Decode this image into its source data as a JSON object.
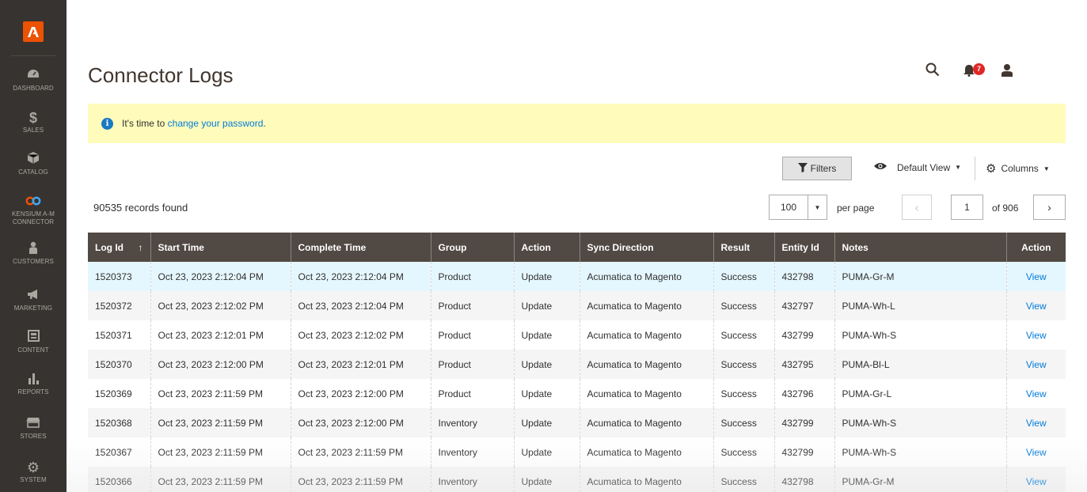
{
  "sidebar": {
    "items": [
      {
        "label": "DASHBOARD",
        "icon": "dashboard-icon"
      },
      {
        "label": "SALES",
        "icon": "dollar-icon"
      },
      {
        "label": "CATALOG",
        "icon": "cube-icon"
      },
      {
        "label": "KENSIUM A-M CONNECTOR",
        "icon": "infinity-icon"
      },
      {
        "label": "CUSTOMERS",
        "icon": "person-icon"
      },
      {
        "label": "MARKETING",
        "icon": "megaphone-icon"
      },
      {
        "label": "CONTENT",
        "icon": "layout-icon"
      },
      {
        "label": "REPORTS",
        "icon": "bar-chart-icon"
      },
      {
        "label": "STORES",
        "icon": "store-icon"
      },
      {
        "label": "SYSTEM",
        "icon": "gear-icon"
      }
    ]
  },
  "header": {
    "title": "Connector Logs",
    "notification_count": "7"
  },
  "message": {
    "prefix": "It's time to ",
    "link": "change your password",
    "suffix": "."
  },
  "toolbar": {
    "filters_label": "Filters",
    "view_label": "Default View",
    "columns_label": "Columns",
    "records_found": "90535 records found",
    "per_page_value": "100",
    "per_page_label": "per page",
    "current_page": "1",
    "total_pages": "of 906"
  },
  "table": {
    "columns": [
      "Log Id",
      "Start Time",
      "Complete Time",
      "Group",
      "Action",
      "Sync Direction",
      "Result",
      "Entity Id",
      "Notes",
      "Action"
    ],
    "rows": [
      {
        "log_id": "1520373",
        "start": "Oct 23, 2023 2:12:04 PM",
        "complete": "Oct 23, 2023 2:12:04 PM",
        "group": "Product",
        "action": "Update",
        "direction": "Acumatica to Magento",
        "result": "Success",
        "entity": "432798",
        "notes": "PUMA-Gr-M",
        "link": "View"
      },
      {
        "log_id": "1520372",
        "start": "Oct 23, 2023 2:12:02 PM",
        "complete": "Oct 23, 2023 2:12:04 PM",
        "group": "Product",
        "action": "Update",
        "direction": "Acumatica to Magento",
        "result": "Success",
        "entity": "432797",
        "notes": "PUMA-Wh-L",
        "link": "View"
      },
      {
        "log_id": "1520371",
        "start": "Oct 23, 2023 2:12:01 PM",
        "complete": "Oct 23, 2023 2:12:02 PM",
        "group": "Product",
        "action": "Update",
        "direction": "Acumatica to Magento",
        "result": "Success",
        "entity": "432799",
        "notes": "PUMA-Wh-S",
        "link": "View"
      },
      {
        "log_id": "1520370",
        "start": "Oct 23, 2023 2:12:00 PM",
        "complete": "Oct 23, 2023 2:12:01 PM",
        "group": "Product",
        "action": "Update",
        "direction": "Acumatica to Magento",
        "result": "Success",
        "entity": "432795",
        "notes": "PUMA-Bl-L",
        "link": "View"
      },
      {
        "log_id": "1520369",
        "start": "Oct 23, 2023 2:11:59 PM",
        "complete": "Oct 23, 2023 2:12:00 PM",
        "group": "Product",
        "action": "Update",
        "direction": "Acumatica to Magento",
        "result": "Success",
        "entity": "432796",
        "notes": "PUMA-Gr-L",
        "link": "View"
      },
      {
        "log_id": "1520368",
        "start": "Oct 23, 2023 2:11:59 PM",
        "complete": "Oct 23, 2023 2:12:00 PM",
        "group": "Inventory",
        "action": "Update",
        "direction": "Acumatica to Magento",
        "result": "Success",
        "entity": "432799",
        "notes": "PUMA-Wh-S",
        "link": "View"
      },
      {
        "log_id": "1520367",
        "start": "Oct 23, 2023 2:11:59 PM",
        "complete": "Oct 23, 2023 2:11:59 PM",
        "group": "Inventory",
        "action": "Update",
        "direction": "Acumatica to Magento",
        "result": "Success",
        "entity": "432799",
        "notes": "PUMA-Wh-S",
        "link": "View"
      },
      {
        "log_id": "1520366",
        "start": "Oct 23, 2023 2:11:59 PM",
        "complete": "Oct 23, 2023 2:11:59 PM",
        "group": "Inventory",
        "action": "Update",
        "direction": "Acumatica to Magento",
        "result": "Success",
        "entity": "432798",
        "notes": "PUMA-Gr-M",
        "link": "View"
      }
    ]
  },
  "colors": {
    "sidebar_bg": "#373330",
    "table_header_bg": "#514943",
    "message_bg": "#fffbbb",
    "link": "#007bdb",
    "brand": "#eb5202"
  }
}
